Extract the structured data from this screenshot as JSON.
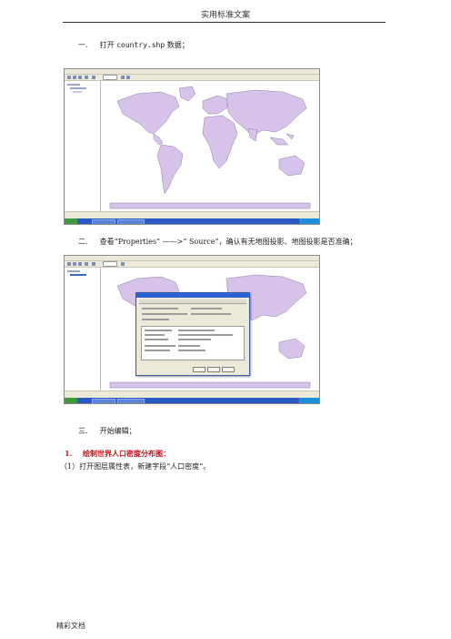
{
  "header": {
    "title": "实用标准文案"
  },
  "step1": {
    "number": "一.",
    "text": "打开",
    "file": "country.shp",
    "suffix": "数据；"
  },
  "step2": {
    "number": "二.",
    "text": "查看”Properties” ——>” Source”，确认有无地图投影、地图投影是否准确；"
  },
  "step3": {
    "number": "三.",
    "text": "开始编辑；"
  },
  "section1": {
    "number": "1.",
    "title": "绘制世界人口密度分布图："
  },
  "substep1": {
    "text": "（1）打开图层属性表，新建字段“人口密度“。"
  },
  "footer": {
    "text": "精彩文档"
  },
  "colors": {
    "land": "#d7c3ea",
    "coast": "#8e7aa6",
    "ocean": "#ffffff",
    "taskbar": "#2a59c6",
    "accent_red": "#c0141c"
  },
  "icons": [
    "arcmap-toolbar-icon",
    "start-button-icon",
    "properties-dialog"
  ]
}
